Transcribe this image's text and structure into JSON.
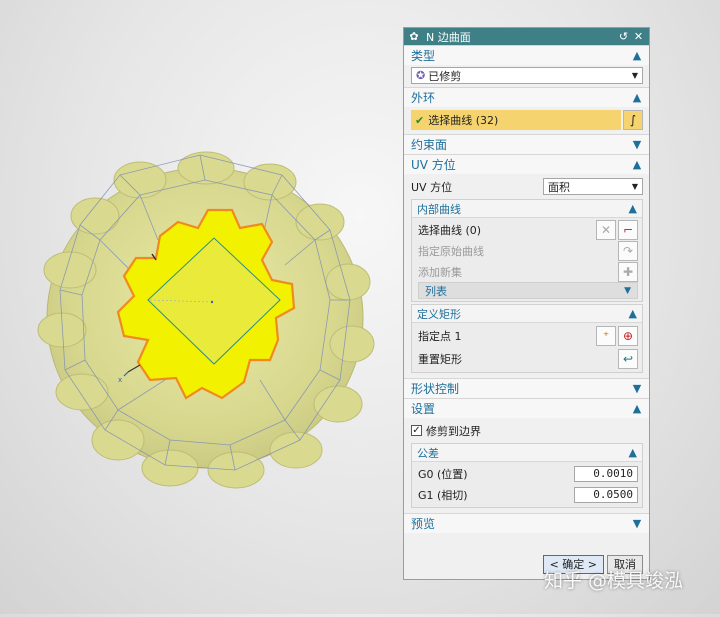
{
  "dialog": {
    "title": "N 边曲面",
    "colors": {
      "titlebar": "#3f7f86",
      "section_label": "#1e6f9a",
      "highlight": "#f5d470",
      "surface_yellow": "#f2f200",
      "boundary_orange": "#f08a1e"
    },
    "sections": {
      "type": {
        "label": "类型",
        "value": "已修剪",
        "icon": "trimmed-surface-icon"
      },
      "outer_loop": {
        "label": "外环",
        "select_label": "选择曲线 (32)"
      },
      "constraint": {
        "label": "约束面"
      },
      "uv": {
        "label": "UV 方位",
        "uv_label": "UV 方位",
        "uv_value": "面积",
        "inner_curves": {
          "label": "内部曲线",
          "select_label": "选择曲线 (0)",
          "specify_original": "指定原始曲线",
          "add_set": "添加新集",
          "list_label": "列表"
        },
        "define_rect": {
          "label": "定义矩形",
          "specify_point": "指定点 1",
          "reset_rect": "重置矩形"
        }
      },
      "shape_control": {
        "label": "形状控制"
      },
      "settings": {
        "label": "设置",
        "trim_to_boundary": "修剪到边界",
        "trim_checked": true,
        "tolerance": {
          "label": "公差",
          "g0_label": "G0 (位置)",
          "g0_value": "0.0010",
          "g1_label": "G1 (相切)",
          "g1_value": "0.0500"
        }
      },
      "preview": {
        "label": "预览"
      }
    },
    "buttons": {
      "ok": "< 确定 >",
      "cancel": "取消"
    }
  },
  "watermark": "知乎 @模具竣泓"
}
